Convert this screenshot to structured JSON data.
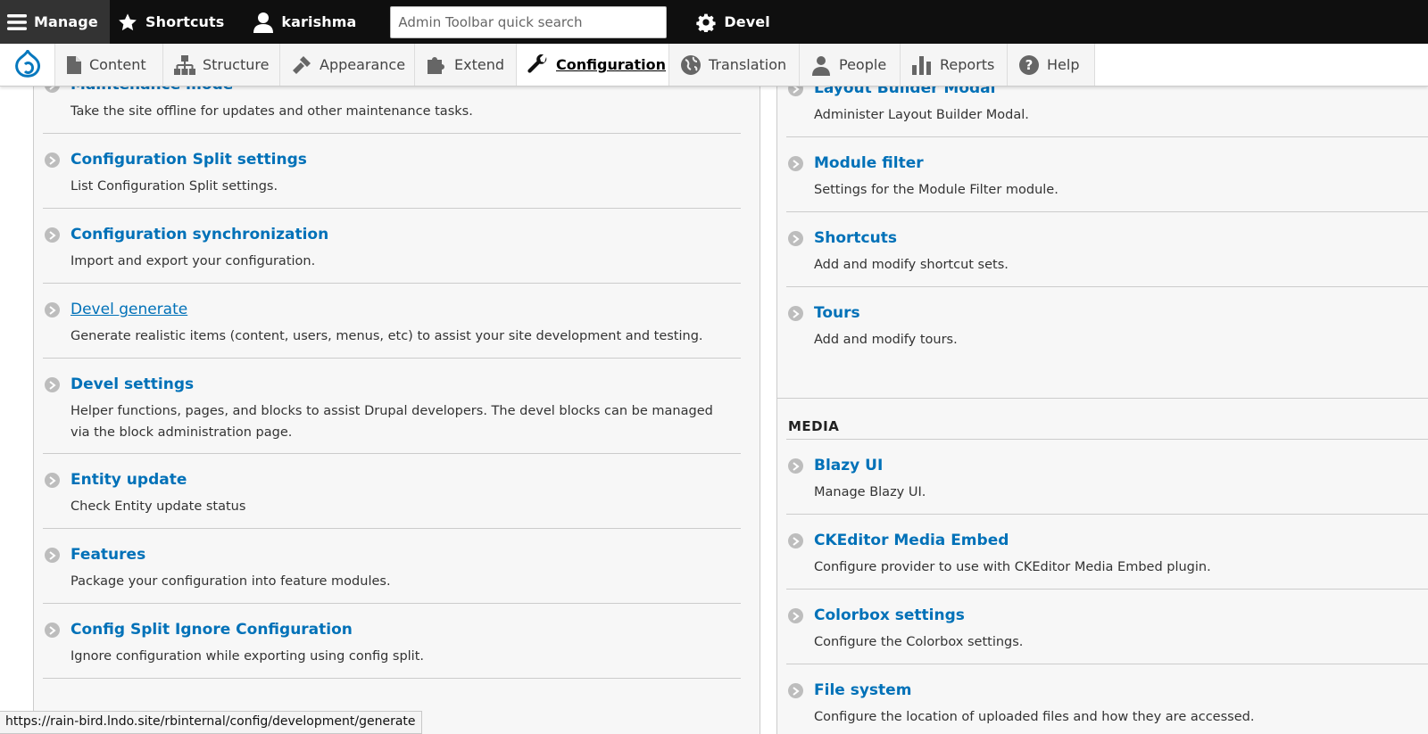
{
  "toolbar": {
    "manage_label": "Manage",
    "shortcuts_label": "Shortcuts",
    "user_label": "karishma",
    "search_placeholder": "Admin Toolbar quick search",
    "devel_label": "Devel"
  },
  "tray": {
    "items": [
      {
        "label": "Content",
        "icon": "page-icon"
      },
      {
        "label": "Structure",
        "icon": "structure-icon"
      },
      {
        "label": "Appearance",
        "icon": "brush-icon"
      },
      {
        "label": "Extend",
        "icon": "puzzle-icon"
      },
      {
        "label": "Configuration",
        "icon": "wrench-icon",
        "active": true
      },
      {
        "label": "Translation",
        "icon": "globe-icon"
      },
      {
        "label": "People",
        "icon": "person-icon"
      },
      {
        "label": "Reports",
        "icon": "bar-chart-icon"
      },
      {
        "label": "Help",
        "icon": "help-icon"
      }
    ]
  },
  "left_panel": {
    "items": [
      {
        "title": "Maintenance mode",
        "desc": "Take the site offline for updates and other maintenance tasks."
      },
      {
        "title": "Configuration Split settings",
        "desc": "List Configuration Split settings."
      },
      {
        "title": "Configuration synchronization",
        "desc": "Import and export your configuration."
      },
      {
        "title": "Devel generate",
        "desc": "Generate realistic items (content, users, menus, etc) to assist your site development and testing."
      },
      {
        "title": "Devel settings",
        "desc": "Helper functions, pages, and blocks to assist Drupal developers. The devel blocks can be managed via the block administration page."
      },
      {
        "title": "Entity update",
        "desc": "Check Entity update status"
      },
      {
        "title": "Features",
        "desc": "Package your configuration into feature modules."
      },
      {
        "title": "Config Split Ignore Configuration",
        "desc": "Ignore configuration while exporting using config split."
      }
    ]
  },
  "right_panel": {
    "items": [
      {
        "title": "Layout Builder Modal",
        "desc": "Administer Layout Builder Modal."
      },
      {
        "title": "Module filter",
        "desc": "Settings for the Module Filter module."
      },
      {
        "title": "Shortcuts",
        "desc": "Add and modify shortcut sets."
      },
      {
        "title": "Tours",
        "desc": "Add and modify tours."
      }
    ]
  },
  "media_panel": {
    "heading": "MEDIA",
    "items": [
      {
        "title": "Blazy UI",
        "desc": "Manage Blazy UI."
      },
      {
        "title": "CKEditor Media Embed",
        "desc": "Configure provider to use with CKEditor Media Embed plugin."
      },
      {
        "title": "Colorbox settings",
        "desc": "Configure the Colorbox settings."
      },
      {
        "title": "File system",
        "desc": "Configure the location of uploaded files and how they are accessed."
      }
    ]
  },
  "status_bar": {
    "url": "https://rain-bird.lndo.site/rbinternal/config/development/generate"
  },
  "colors": {
    "link": "#0071b8",
    "toolbar_bg": "#0f0f0f",
    "drupal_blue": "#0678be"
  }
}
